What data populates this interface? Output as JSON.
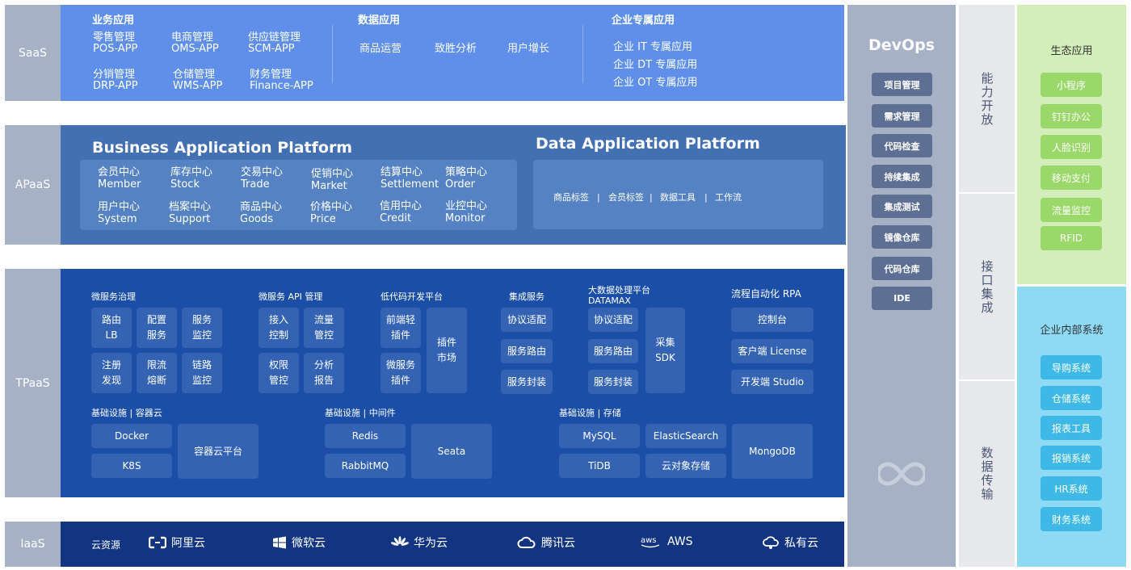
{
  "layers": {
    "saas": "SaaS",
    "apaas": "APaaS",
    "tpaas": "TPaaS",
    "iaas": "IaaS"
  },
  "saas": {
    "biz": {
      "title": "业务应用",
      "items": [
        {
          "cn": "零售管理",
          "en": "POS-APP"
        },
        {
          "cn": "电商管理",
          "en": "OMS-APP"
        },
        {
          "cn": "供应链管理",
          "en": "SCM-APP"
        },
        {
          "cn": "分销管理",
          "en": "DRP-APP"
        },
        {
          "cn": "仓储管理",
          "en": "WMS-APP"
        },
        {
          "cn": "财务管理",
          "en": "Finance-APP"
        }
      ]
    },
    "data": {
      "title": "数据应用",
      "items": [
        "商品运营",
        "致胜分析",
        "用户增长"
      ]
    },
    "ent": {
      "title": "企业专属应用",
      "items": [
        "企业 IT 专属应用",
        "企业 DT 专属应用",
        "企业 OT 专属应用"
      ]
    }
  },
  "apaas": {
    "bap": {
      "title": "Business Application Platform",
      "items": [
        {
          "cn": "会员中心",
          "en": "Member"
        },
        {
          "cn": "库存中心",
          "en": "Stock"
        },
        {
          "cn": "交易中心",
          "en": "Trade"
        },
        {
          "cn": "促销中心",
          "en": "Market"
        },
        {
          "cn": "结算中心",
          "en": "Settlement"
        },
        {
          "cn": "策略中心",
          "en": "Order"
        },
        {
          "cn": "用户中心",
          "en": "System"
        },
        {
          "cn": "档案中心",
          "en": "Support"
        },
        {
          "cn": "商品中心",
          "en": "Goods"
        },
        {
          "cn": "价格中心",
          "en": "Price"
        },
        {
          "cn": "信用中心",
          "en": "Credit"
        },
        {
          "cn": "业控中心",
          "en": "Monitor"
        }
      ]
    },
    "dap": {
      "title": "Data Application Platform",
      "items": [
        "商品标签",
        "会员标签",
        "数据工具",
        "工作流"
      ],
      "sep": "|"
    }
  },
  "tpaas": {
    "micro": {
      "title": "微服务治理",
      "boxes": [
        "路由\nLB",
        "配置\n服务",
        "服务\n监控",
        "注册\n发现",
        "限流\n熔断",
        "链路\n监控"
      ]
    },
    "api": {
      "title": "微服务 API 管理",
      "boxes": [
        "接入\n控制",
        "流量\n管控",
        "权限\n管控",
        "分析\n报告"
      ]
    },
    "lowcode": {
      "title": "低代码开发平台",
      "boxes": [
        "前端轻\n插件",
        "微服务\n插件",
        "插件\n市场"
      ]
    },
    "integ": {
      "title": "集成服务",
      "boxes": [
        "协议适配",
        "服务路由",
        "服务封装"
      ]
    },
    "bigdata": {
      "title": "大数据处理平台",
      "subtitle": "DATAMAX",
      "boxes": [
        "协议适配",
        "服务路由",
        "服务封装",
        "采集\nSDK"
      ]
    },
    "rpa": {
      "title": "流程自动化 RPA",
      "boxes": [
        "控制台",
        "客户端 License",
        "开发端 Studio"
      ]
    },
    "container": {
      "title": "基础设施 | 容器云",
      "boxes": [
        "Docker",
        "K8S",
        "容器云平台"
      ]
    },
    "middleware": {
      "title": "基础设施 | 中间件",
      "boxes": [
        "Redis",
        "RabbitMQ",
        "Seata"
      ]
    },
    "storage": {
      "title": "基础设施 | 存储",
      "boxes": [
        "MySQL",
        "ElasticSearch",
        "TiDB",
        "云对象存储",
        "MongoDB"
      ]
    }
  },
  "iaas": {
    "label": "云资源",
    "clouds": [
      {
        "name": "阿里云",
        "icon": "aliyun-icon"
      },
      {
        "name": "微软云",
        "icon": "windows-icon"
      },
      {
        "name": "华为云",
        "icon": "huawei-icon"
      },
      {
        "name": "腾讯云",
        "icon": "tencent-cloud-icon"
      },
      {
        "name": "AWS",
        "icon": "aws-icon"
      },
      {
        "name": "私有云",
        "icon": "private-cloud-icon"
      }
    ]
  },
  "devops": {
    "title": "DevOps",
    "items": [
      "项目管理",
      "需求管理",
      "代码检查",
      "持续集成",
      "集成测试",
      "镜像仓库",
      "代码仓库",
      "IDE"
    ]
  },
  "capability": [
    "能力开放",
    "接口集成",
    "数据传输"
  ],
  "eco": {
    "title": "生态应用",
    "items": [
      "小程序",
      "钉钉办公",
      "人脸识别",
      "移动支付",
      "流量监控",
      "RFID"
    ]
  },
  "internal": {
    "title": "企业内部系统",
    "items": [
      "导购系统",
      "仓储系统",
      "报表工具",
      "报销系统",
      "HR系统",
      "财务系统"
    ]
  },
  "colors": {
    "saas": "#5f8fe8",
    "apaas": "#4270b3",
    "tpaas": "#1b4ea6",
    "iaas": "#133480",
    "devops": "#a6b1c6",
    "eco": "#d3edbb",
    "internal": "#8edaf5"
  }
}
